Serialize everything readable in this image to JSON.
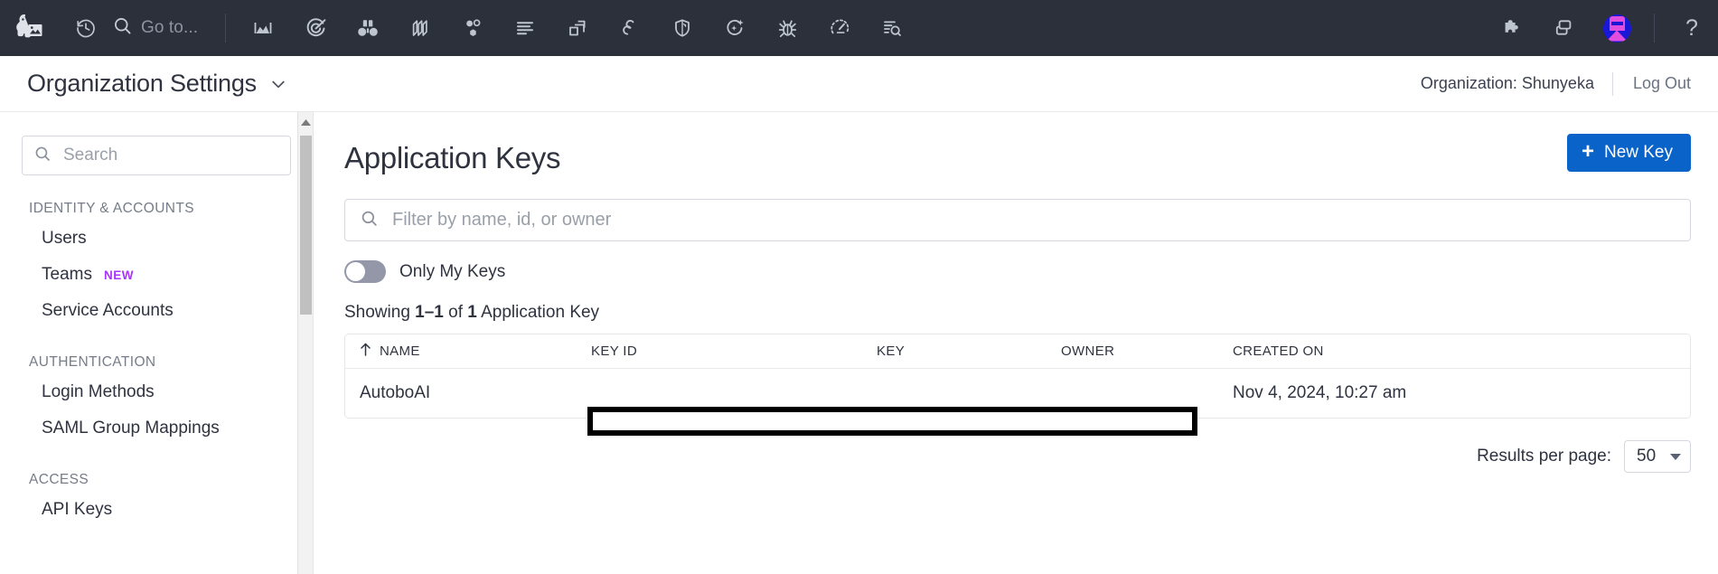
{
  "topnav": {
    "logo_icon": "datadog-dog-logo",
    "recent_icon": "history-clock-icon",
    "search_icon": "search-icon",
    "goto_label": "Go to...",
    "icons": [
      {
        "name": "dashboards-icon",
        "label": "Dashboards"
      },
      {
        "name": "monitors-target-icon",
        "label": "Monitors"
      },
      {
        "name": "watchdog-binoculars-icon",
        "label": "Watchdog"
      },
      {
        "name": "logs-layers-icon",
        "label": "Logs"
      },
      {
        "name": "apm-nodes-icon",
        "label": "APM"
      },
      {
        "name": "infrastructure-list-icon",
        "label": "Infrastructure"
      },
      {
        "name": "containers-stack-icon",
        "label": "Containers"
      },
      {
        "name": "synthetics-link-icon",
        "label": "Synthetics"
      },
      {
        "name": "security-shield-icon",
        "label": "Security"
      },
      {
        "name": "ai-sparkle-icon",
        "label": "AI"
      },
      {
        "name": "error-tracking-bug-icon",
        "label": "Error Tracking"
      },
      {
        "name": "performance-gauge-icon",
        "label": "Performance"
      },
      {
        "name": "log-explorer-search-icon",
        "label": "Log Explorer"
      }
    ],
    "right_icons": [
      {
        "name": "integrations-puzzle-icon",
        "label": "Integrations"
      },
      {
        "name": "notebooks-copy-icon",
        "label": "Notebooks"
      }
    ],
    "avatar_name": "user-avatar",
    "help_glyph": "?"
  },
  "header": {
    "title": "Organization Settings",
    "caret_icon": "chevron-down-icon",
    "organization": "Organization: Shunyeka",
    "logout_label": "Log Out"
  },
  "sidebar": {
    "search_placeholder": "Search",
    "search_value": "",
    "search_icon": "search-icon",
    "groups": [
      {
        "title": "IDENTITY & ACCOUNTS",
        "items": [
          {
            "label": "Users",
            "badge": ""
          },
          {
            "label": "Teams",
            "badge": "NEW"
          },
          {
            "label": "Service Accounts",
            "badge": ""
          }
        ]
      },
      {
        "title": "AUTHENTICATION",
        "items": [
          {
            "label": "Login Methods",
            "badge": ""
          },
          {
            "label": "SAML Group Mappings",
            "badge": ""
          }
        ]
      },
      {
        "title": "ACCESS",
        "items": [
          {
            "label": "API Keys",
            "badge": ""
          }
        ]
      }
    ],
    "scrollbar_up_icon": "scroll-up-arrow-icon"
  },
  "main": {
    "page_title": "Application Keys",
    "new_key_label": "New Key",
    "new_key_plus_icon": "plus-icon",
    "new_key_color": "#0a63c9",
    "filter_placeholder": "Filter by name, id, or owner",
    "filter_value": "",
    "filter_icon": "search-icon",
    "toggle": {
      "name": "only-my-keys-toggle",
      "label": "Only My Keys",
      "checked": false
    },
    "showing": {
      "prefix": "Showing ",
      "range": "1–1",
      "mid": " of ",
      "count": "1",
      "suffix": " Application Key"
    },
    "table": {
      "sort_icon": "sort-ascending-arrow-icon",
      "columns": [
        "NAME",
        "KEY ID",
        "KEY",
        "OWNER",
        "CREATED ON"
      ],
      "rows": [
        {
          "name": "AutoboAI",
          "key_id": "",
          "key": "",
          "owner": "",
          "created_on": "Nov 4, 2024, 10:27 am"
        }
      ],
      "redaction_name": "redaction-box"
    },
    "pagination": {
      "label": "Results per page:",
      "value": "50",
      "caret_icon": "caret-down-icon"
    }
  }
}
